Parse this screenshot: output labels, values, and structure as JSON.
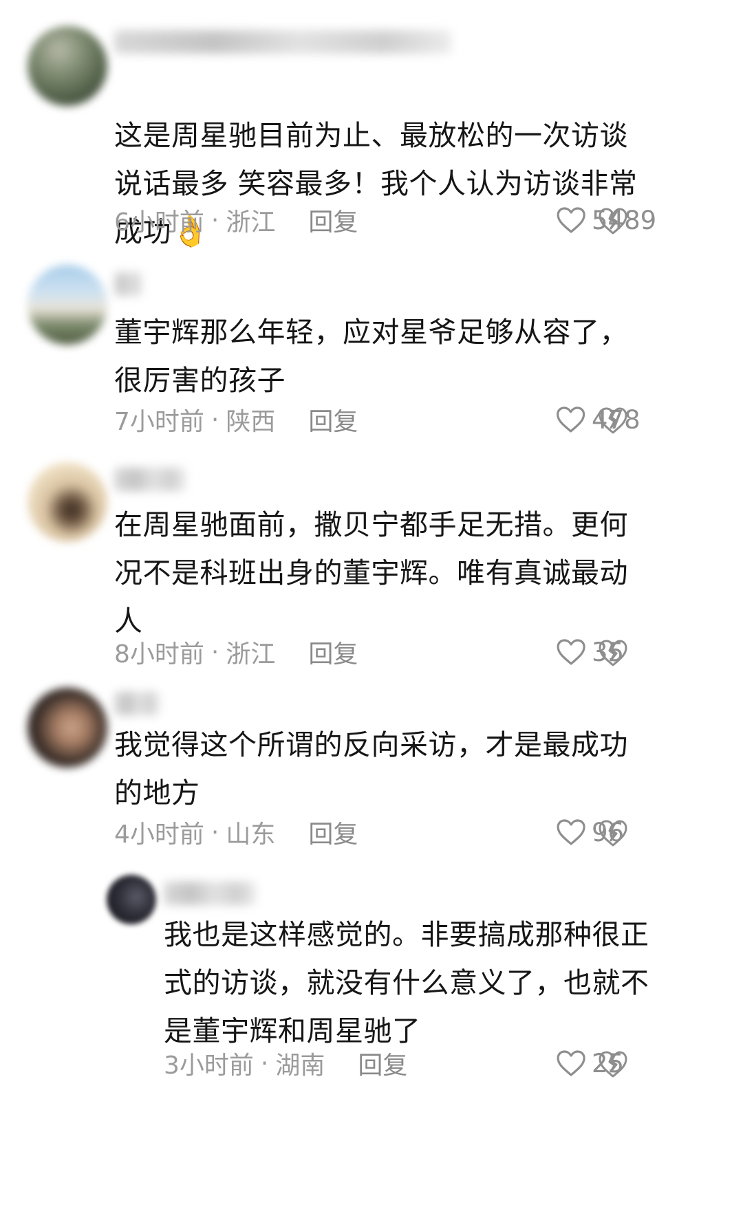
{
  "comments": [
    {
      "text": "这是周星驰目前为止、最放松的一次访谈\n说话最多 笑容最多！我个人认为访谈非常\n成功",
      "emoji": "👌",
      "time": "6小时前",
      "location": "浙江",
      "reply": "回复",
      "likes": "5489"
    },
    {
      "text": "董宇辉那么年轻，应对星爷足够从容了，\n很厉害的孩子",
      "time": "7小时前",
      "location": "陕西",
      "reply": "回复",
      "likes": "478"
    },
    {
      "text": "在周星驰面前，撒贝宁都手足无措。更何\n况不是科班出身的董宇辉。唯有真诚最动\n人",
      "time": "8小时前",
      "location": "浙江",
      "reply": "回复",
      "likes": "35"
    },
    {
      "text": "我觉得这个所谓的反向采访，才是最成功\n的地方",
      "time": "4小时前",
      "location": "山东",
      "reply": "回复",
      "likes": "96"
    },
    {
      "text": "我也是这样感觉的。非要搞成那种很正\n式的访谈，就没有什么意义了，也就不\n是董宇辉和周星驰了",
      "time": "3小时前",
      "location": "湖南",
      "reply": "回复",
      "likes": "25"
    }
  ],
  "separator": "·"
}
